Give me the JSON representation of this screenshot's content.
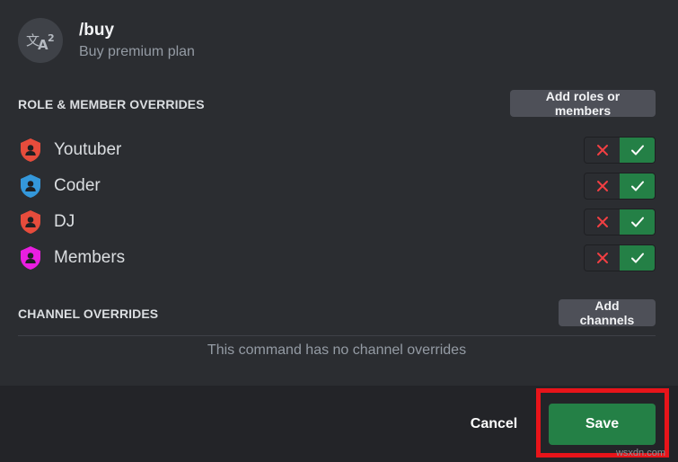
{
  "command": {
    "name": "/buy",
    "description": "Buy premium plan",
    "icon": "translate-icon"
  },
  "role_overrides": {
    "title": "ROLE & MEMBER OVERRIDES",
    "add_button": "Add roles or members",
    "roles": [
      {
        "name": "Youtuber",
        "color": "#e74c3c",
        "allowed": true
      },
      {
        "name": "Coder",
        "color": "#3498db",
        "allowed": true
      },
      {
        "name": "DJ",
        "color": "#e74c3c",
        "allowed": true
      },
      {
        "name": "Members",
        "color": "#e91ee0",
        "allowed": true
      }
    ]
  },
  "channel_overrides": {
    "title": "CHANNEL OVERRIDES",
    "add_button": "Add channels",
    "empty_message": "This command has no channel overrides"
  },
  "footer": {
    "cancel_label": "Cancel",
    "save_label": "Save"
  },
  "watermark": "wsxdn.com",
  "colors": {
    "accent_green": "#248046",
    "deny_red": "#f23f43",
    "highlight_red": "#e8141a"
  }
}
